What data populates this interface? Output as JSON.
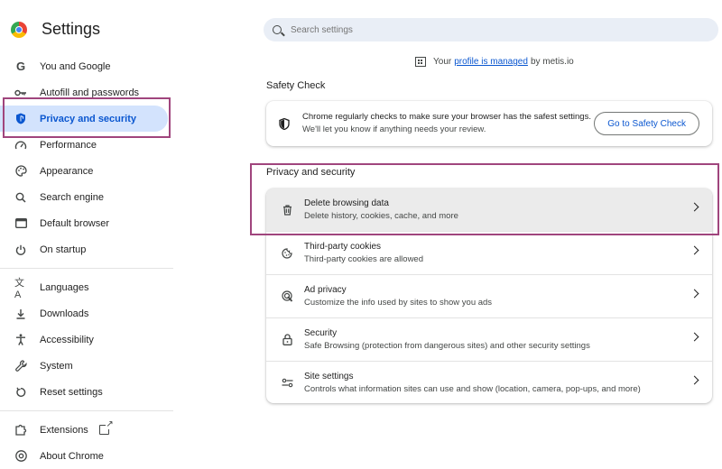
{
  "app": {
    "title": "Settings"
  },
  "sidebar": {
    "items": [
      {
        "label": "You and Google",
        "icon": "google-g-icon"
      },
      {
        "label": "Autofill and passwords",
        "icon": "key-icon"
      },
      {
        "label": "Privacy and security",
        "icon": "shield-icon",
        "active": true
      },
      {
        "label": "Performance",
        "icon": "speedometer-icon"
      },
      {
        "label": "Appearance",
        "icon": "palette-icon"
      },
      {
        "label": "Search engine",
        "icon": "search-icon"
      },
      {
        "label": "Default browser",
        "icon": "browser-window-icon"
      },
      {
        "label": "On startup",
        "icon": "power-icon"
      },
      {
        "label": "Languages",
        "icon": "translate-icon"
      },
      {
        "label": "Downloads",
        "icon": "download-icon"
      },
      {
        "label": "Accessibility",
        "icon": "accessibility-icon"
      },
      {
        "label": "System",
        "icon": "wrench-icon"
      },
      {
        "label": "Reset settings",
        "icon": "reset-icon"
      },
      {
        "label": "Extensions",
        "icon": "puzzle-icon"
      },
      {
        "label": "About Chrome",
        "icon": "chrome-logo-icon"
      }
    ]
  },
  "search": {
    "placeholder": "Search settings"
  },
  "managed": {
    "prefix": "Your",
    "link": "profile is managed",
    "suffix": "by metis.io"
  },
  "safety_check": {
    "heading": "Safety Check",
    "line1": "Chrome regularly checks to make sure your browser has the safest settings.",
    "line2": "We'll let you know if anything needs your review.",
    "button": "Go to Safety Check"
  },
  "privacy": {
    "heading": "Privacy and security",
    "rows": [
      {
        "title": "Delete browsing data",
        "subtitle": "Delete history, cookies, cache, and more",
        "icon": "trash-icon"
      },
      {
        "title": "Third-party cookies",
        "subtitle": "Third-party cookies are allowed",
        "icon": "cookie-icon"
      },
      {
        "title": "Ad privacy",
        "subtitle": "Customize the info used by sites to show you ads",
        "icon": "ad-privacy-icon"
      },
      {
        "title": "Security",
        "subtitle": "Safe Browsing (protection from dangerous sites) and other security settings",
        "icon": "lock-icon"
      },
      {
        "title": "Site settings",
        "subtitle": "Controls what information sites can use and show (location, camera, pop-ups, and more)",
        "icon": "sliders-icon"
      }
    ]
  },
  "colors": {
    "accent": "#0b57d0",
    "active_bg": "#d3e3fd",
    "highlight": "#a0457d"
  }
}
